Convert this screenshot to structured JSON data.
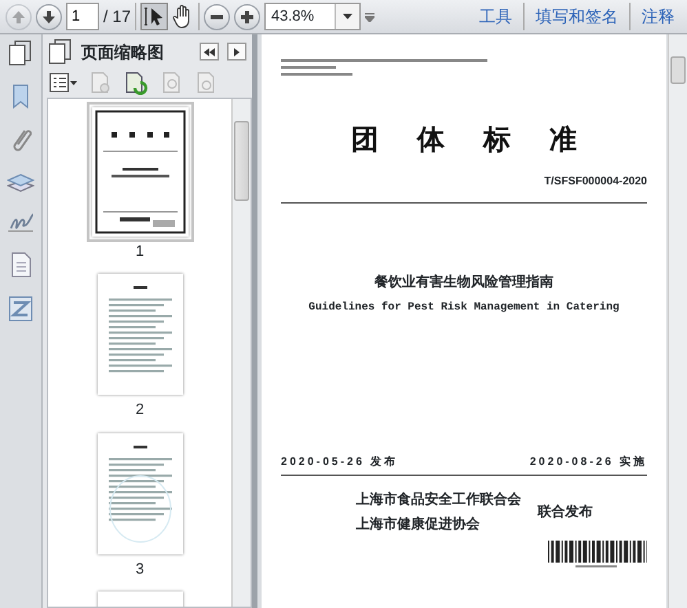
{
  "toolbar": {
    "page_current": "1",
    "page_total": "/ 17",
    "zoom": "43.8%",
    "prev_disabled": true,
    "menus": [
      "工具",
      "填写和签名",
      "注释"
    ]
  },
  "panel": {
    "title": "页面缩略图",
    "thumbnails": [
      {
        "label": "1",
        "selected": true,
        "kind": "cover"
      },
      {
        "label": "2",
        "selected": false,
        "kind": "contents"
      },
      {
        "label": "3",
        "selected": false,
        "kind": "text"
      }
    ]
  },
  "document": {
    "heading": "团体标准",
    "code": "T/SFSF000004-2020",
    "title_zh": "餐饮业有害生物风险管理指南",
    "title_en": "Guidelines for Pest Risk Management in Catering",
    "publish_date": "2020-05-26 发布",
    "effective_date": "2020-08-26 实施",
    "publishers": [
      "上海市食品安全工作联合会",
      "上海市健康促进协会"
    ],
    "joint_label": "联合发布"
  }
}
